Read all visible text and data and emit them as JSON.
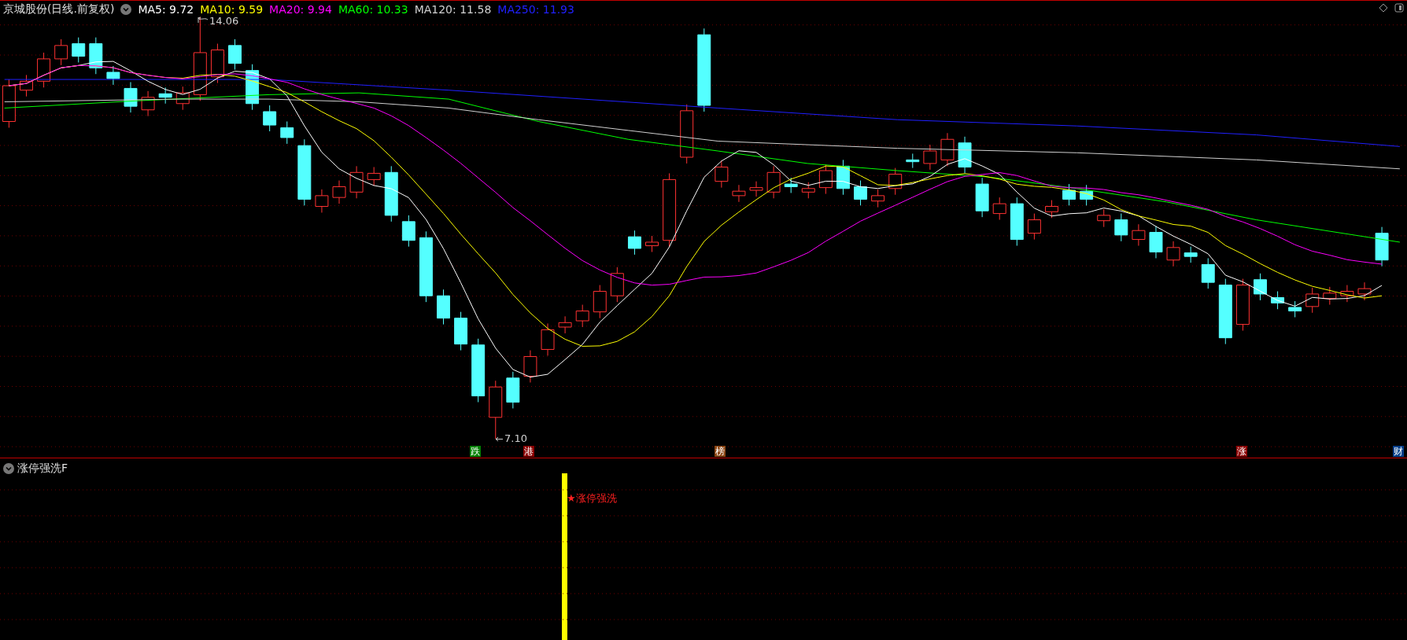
{
  "header": {
    "title": "京城股份(日线.前复权)",
    "indicators": [
      {
        "label": "MA5:",
        "value": "9.72",
        "color": "#ffffff"
      },
      {
        "label": "MA10:",
        "value": "9.59",
        "color": "#ffff00"
      },
      {
        "label": "MA20:",
        "value": "9.94",
        "color": "#ff00ff"
      },
      {
        "label": "MA60:",
        "value": "10.33",
        "color": "#00ff00"
      },
      {
        "label": "MA120:",
        "value": "11.58",
        "color": "#d0d0d0"
      },
      {
        "label": "MA250:",
        "value": "11.93",
        "color": "#2020ff"
      }
    ]
  },
  "chart": {
    "high_label": "14.06",
    "low_label": "7.10",
    "markers": [
      {
        "text": "跌",
        "color": "#008000"
      },
      {
        "text": "港",
        "color": "#8b0000"
      },
      {
        "text": "榜",
        "color": "#8b4513"
      },
      {
        "text": "涨",
        "color": "#8b0000"
      },
      {
        "text": "财",
        "color": "#003f8a"
      }
    ]
  },
  "indicator_panel": {
    "title": "涨停强洗F",
    "signal": "★涨停强洗"
  }
}
